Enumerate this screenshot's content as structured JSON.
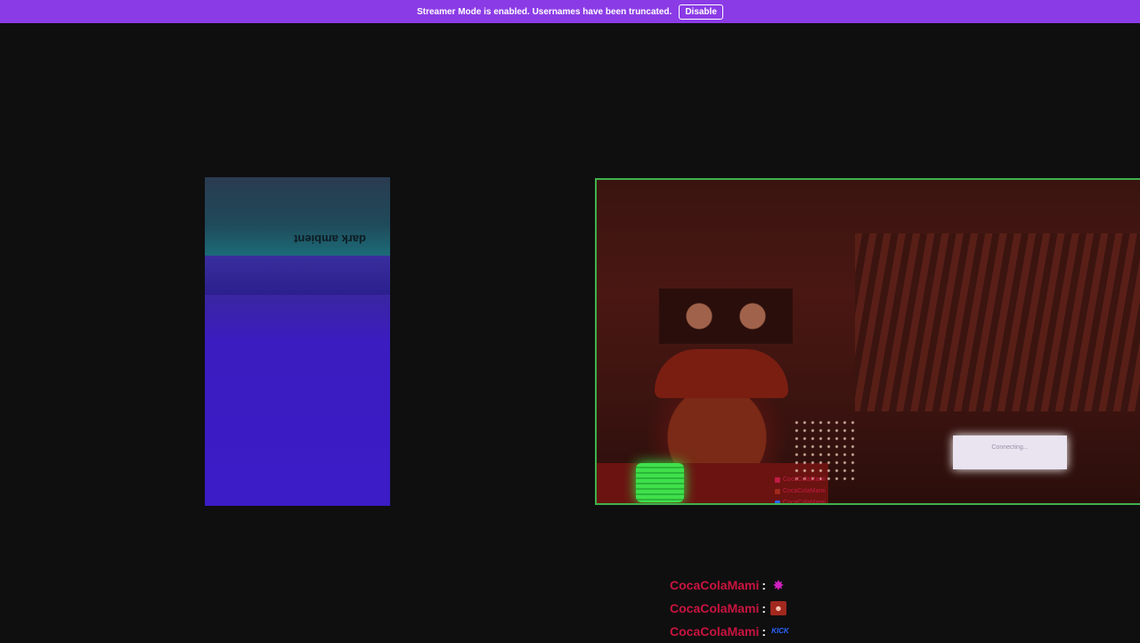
{
  "banner": {
    "message": "Streamer Mode is enabled. Usernames have been truncated.",
    "button_label": "Disable",
    "color": "#8b3be6"
  },
  "phone_feed": {
    "screen_title": "dark ambient"
  },
  "webcam": {
    "border_color": "#3fb24c",
    "laptop_text": "Connecting..."
  },
  "chat": {
    "messages": [
      {
        "user": "CocaColaMami",
        "emote": "cannabis-leaf-emote",
        "emote_glyph": "✸"
      },
      {
        "user": "CocaColaMami",
        "emote": "portrait-emote",
        "emote_glyph": "☻"
      },
      {
        "user": "CocaColaMami",
        "emote": "kick-emote",
        "emote_glyph": "KICK"
      }
    ],
    "user_color": "#c9143f"
  }
}
